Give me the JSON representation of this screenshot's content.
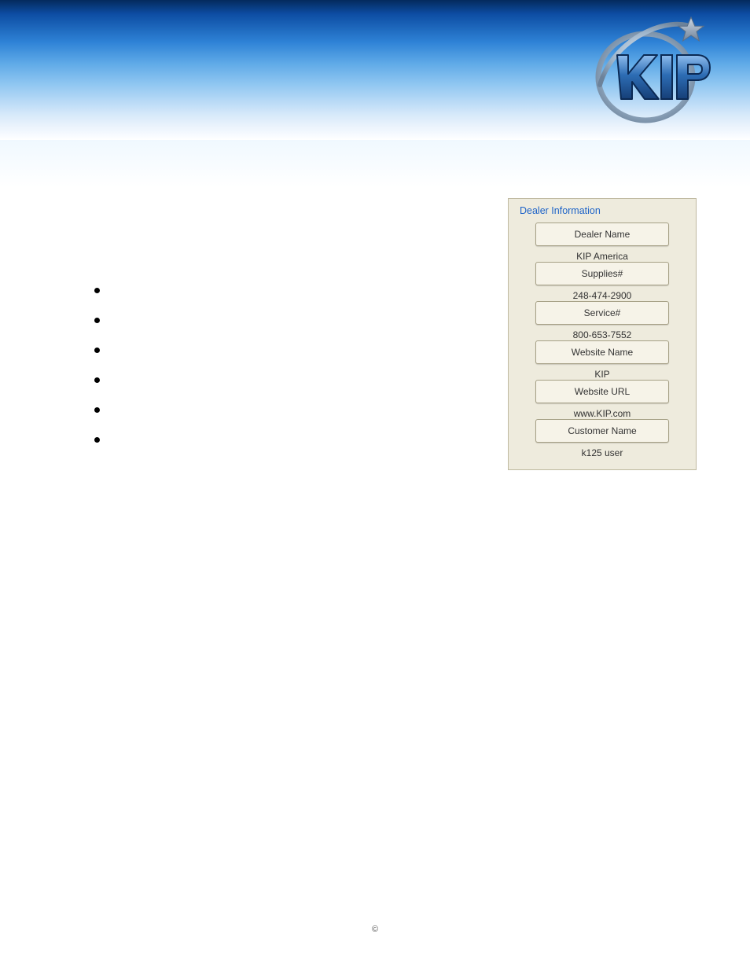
{
  "brand": {
    "name": "KIP"
  },
  "panel": {
    "title": "Dealer Information",
    "items": [
      {
        "label": "Dealer Name",
        "value": "KIP America"
      },
      {
        "label": "Supplies#",
        "value": "248-474-2900"
      },
      {
        "label": "Service#",
        "value": "800-653-7552"
      },
      {
        "label": "Website Name",
        "value": "KIP"
      },
      {
        "label": "Website URL",
        "value": "www.KIP.com"
      },
      {
        "label": "Customer Name",
        "value": "k125 user"
      }
    ]
  },
  "bullets": [
    "",
    "",
    "",
    "",
    "",
    ""
  ],
  "footer": {
    "copyright": "©"
  }
}
